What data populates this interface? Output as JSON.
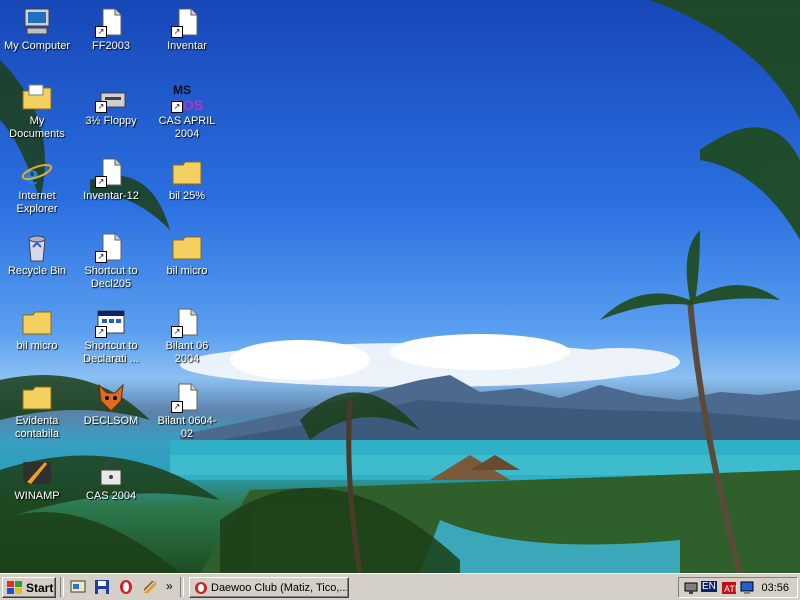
{
  "desktop": {
    "icons": [
      {
        "label": "My Computer",
        "icon": "my-computer-icon"
      },
      {
        "label": "FF2003",
        "icon": "shortcut-file-icon"
      },
      {
        "label": "Inventar",
        "icon": "shortcut-file-icon"
      },
      {
        "label": "My Documents",
        "icon": "my-documents-icon"
      },
      {
        "label": "3½ Floppy",
        "icon": "floppy-shortcut-icon"
      },
      {
        "label": "CAS APRIL 2004",
        "icon": "ms-dos-icon"
      },
      {
        "label": "Internet Explorer",
        "icon": "internet-explorer-icon"
      },
      {
        "label": "Inventar-12",
        "icon": "shortcut-file-icon"
      },
      {
        "label": "bil 25%",
        "icon": "folder-icon"
      },
      {
        "label": "Recycle Bin",
        "icon": "recycle-bin-icon"
      },
      {
        "label": "Shortcut to Decl205",
        "icon": "shortcut-file-icon"
      },
      {
        "label": "bil micro",
        "icon": "folder-icon"
      },
      {
        "label": "bil micro",
        "icon": "folder-icon"
      },
      {
        "label": "Shortcut to Declarati ...",
        "icon": "program-shortcut-icon"
      },
      {
        "label": "Bilant 06 2004",
        "icon": "shortcut-file-icon"
      },
      {
        "label": "Evidenta contabila",
        "icon": "folder-icon"
      },
      {
        "label": "DECLSOM",
        "icon": "fox-icon"
      },
      {
        "label": "Bilant 0604-02",
        "icon": "shortcut-file-icon"
      },
      {
        "label": "WINAMP",
        "icon": "winamp-icon"
      },
      {
        "label": "CAS 2004",
        "icon": "cas-lock-icon"
      }
    ]
  },
  "taskbar": {
    "start_label": "Start",
    "task_label": "Daewoo Club (Matiz, Tico,...",
    "tray_lang": "EN",
    "clock": "03:56",
    "more_chevron": "»"
  },
  "colors": {
    "selection": "#0a246a",
    "taskbar": "#d4d0c8"
  }
}
